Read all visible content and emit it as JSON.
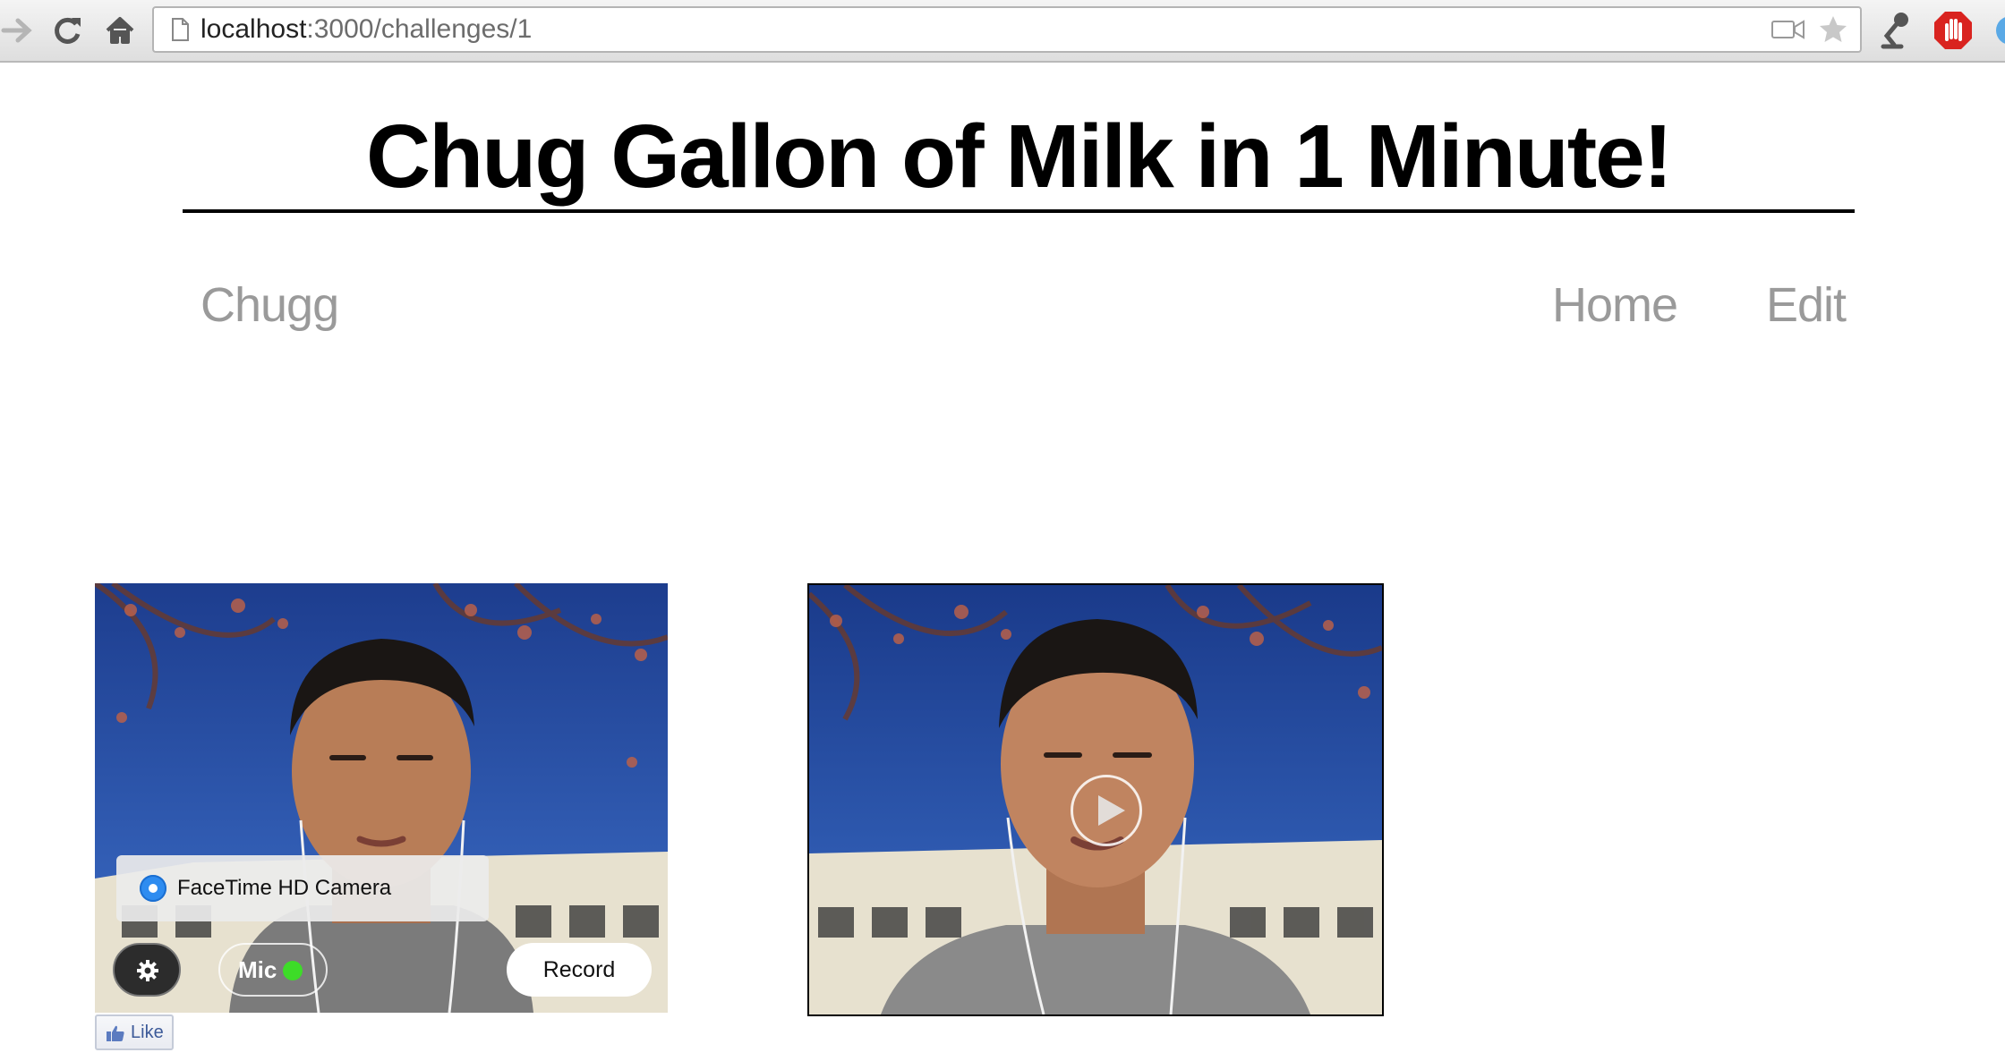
{
  "browser": {
    "url_host": "localhost",
    "url_path": ":3000/challenges/1"
  },
  "page": {
    "title": "Chug Gallon of Milk in 1 Minute!",
    "brand": "Chugg",
    "nav": {
      "home": "Home",
      "edit": "Edit"
    }
  },
  "recorder": {
    "camera_option": "FaceTime HD Camera",
    "mic_label": "Mic",
    "record_label": "Record",
    "mic_status_color": "#3ddc28"
  },
  "like": {
    "label": "Like"
  }
}
